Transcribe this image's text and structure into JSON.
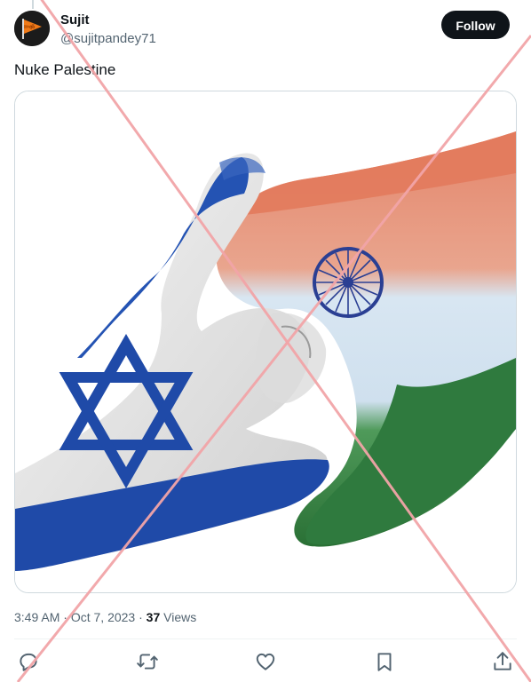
{
  "user": {
    "name": "Sujit",
    "handle": "@sujitpandey71"
  },
  "follow_label": "Follow",
  "tweet": {
    "text": "Nuke Palestine"
  },
  "meta": {
    "time": "3:49 AM",
    "separator": "·",
    "date": "Oct 7, 2023",
    "view_count": "37",
    "views_label": "Views"
  },
  "icons": {
    "reply": "reply-icon",
    "retweet": "retweet-icon",
    "like": "heart-icon",
    "bookmark": "bookmark-icon",
    "share": "share-icon"
  },
  "colors": {
    "text": "#0f1419",
    "secondary": "#536471",
    "follow_bg": "#0f1419",
    "israel_blue": "#1f4aa8",
    "india_saffron": "#e98b6a",
    "india_green": "#2f7a3e",
    "ashoka_blue": "#2a3f93",
    "cross_overlay": "#f2a5a8"
  }
}
